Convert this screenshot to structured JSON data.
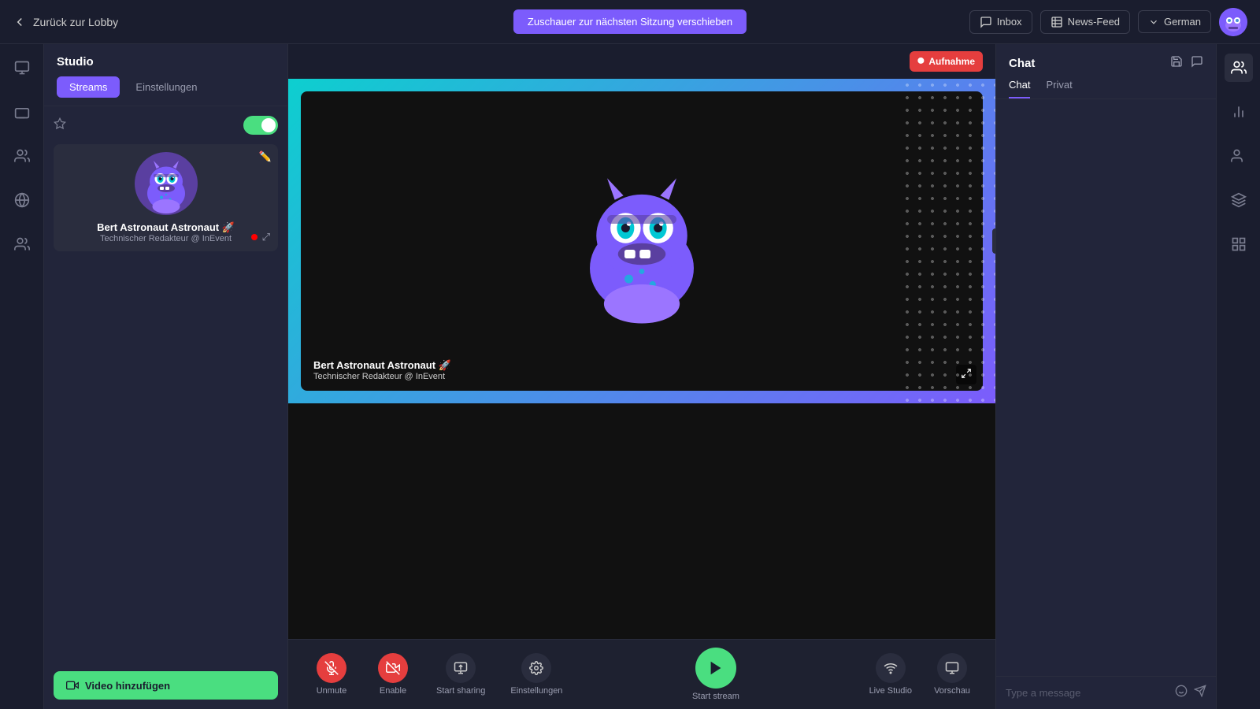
{
  "topbar": {
    "back_label": "Zurück zur Lobby",
    "transfer_btn": "Zuschauer zur nächsten Sitzung verschieben",
    "inbox_label": "Inbox",
    "newsfeed_label": "News-Feed",
    "language_label": "German"
  },
  "studio": {
    "title": "Studio",
    "tab_streams": "Streams",
    "tab_settings": "Einstellungen",
    "recording_badge": "Aufnahme",
    "participant_name": "Bert Astronaut Astronaut 🚀",
    "participant_role": "Technischer Redakteur @ InEvent",
    "add_video_btn": "Video hinzufügen",
    "video_label_name": "Bert Astronaut Astronaut 🚀",
    "video_label_role": "Technischer Redakteur @ InEvent"
  },
  "controls": {
    "unmute_label": "Unmute",
    "enable_label": "Enable",
    "start_sharing_label": "Start sharing",
    "settings_label": "Einstellungen",
    "start_stream_label": "Start stream",
    "live_studio_label": "Live Studio",
    "preview_label": "Vorschau"
  },
  "chat": {
    "title": "Chat",
    "tab_chat": "Chat",
    "tab_private": "Privat",
    "input_placeholder": "Type a message"
  }
}
